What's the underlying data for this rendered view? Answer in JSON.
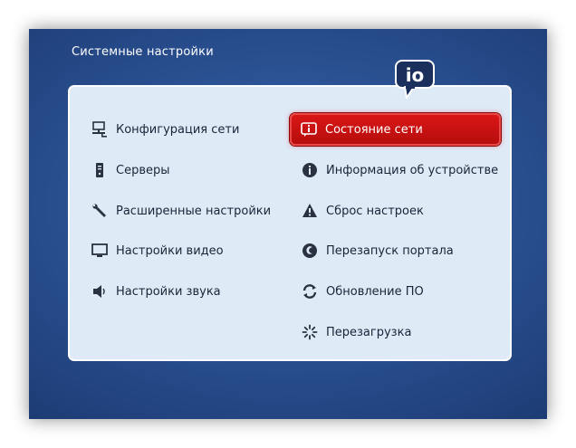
{
  "header": {
    "title": "Системные настройки"
  },
  "logo": {
    "text": "io"
  },
  "menu": {
    "left": [
      {
        "label": "Конфигурация сети",
        "icon": "network-computer-icon"
      },
      {
        "label": "Серверы",
        "icon": "server-icon"
      },
      {
        "label": "Расширенные настройки",
        "icon": "wrench-icon"
      },
      {
        "label": "Настройки видео",
        "icon": "monitor-icon"
      },
      {
        "label": "Настройки звука",
        "icon": "speaker-icon"
      }
    ],
    "right": [
      {
        "label": "Состояние сети",
        "icon": "info-speech-icon",
        "selected": true
      },
      {
        "label": "Информация об устройстве",
        "icon": "info-circle-icon"
      },
      {
        "label": "Сброс настроек",
        "icon": "warning-icon"
      },
      {
        "label": "Перезапуск портала",
        "icon": "swirl-icon"
      },
      {
        "label": "Обновление ПО",
        "icon": "refresh-icon"
      },
      {
        "label": "Перезагрузка",
        "icon": "reboot-spinner-icon"
      }
    ]
  },
  "colors": {
    "background": "#2c5395",
    "panel": "#dfeaf7",
    "selected": "#cc1111",
    "text": "#1a2438"
  }
}
